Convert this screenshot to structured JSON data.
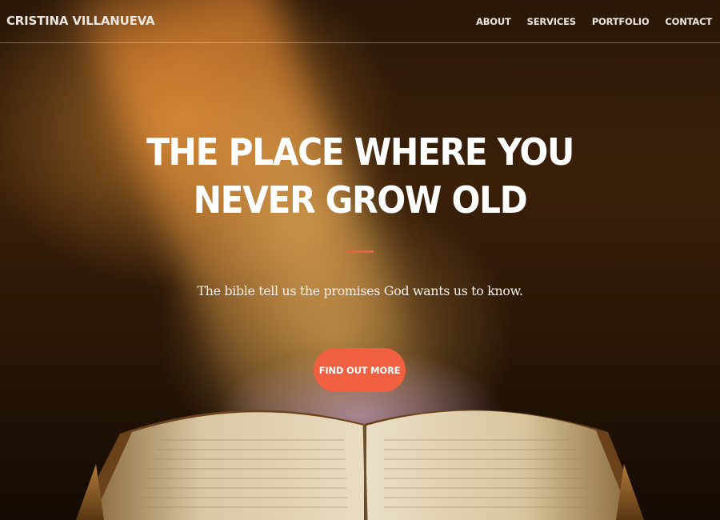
{
  "navbar": {
    "brand": "CRISTINA VILLANUEVA",
    "links": [
      {
        "label": "ABOUT"
      },
      {
        "label": "SERVICES"
      },
      {
        "label": "PORTFOLIO"
      },
      {
        "label": "CONTACT"
      }
    ]
  },
  "hero": {
    "headline": "THE PLACE WHERE YOU NEVER GROW OLD",
    "subtitle": "The bible tell us the promises God wants us to know.",
    "cta_label": "FIND OUT MORE",
    "background_image": "open-bible-light-beam"
  },
  "colors": {
    "accent": "#f05f40",
    "text": "#ffffff"
  }
}
